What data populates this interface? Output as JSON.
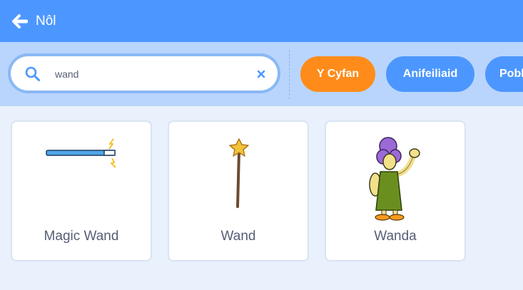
{
  "header": {
    "back_label": "Nôl",
    "back_icon": "arrow-left-icon",
    "color": "#4c97ff"
  },
  "search": {
    "value": "wand",
    "search_icon": "search-icon",
    "clear_icon": "close-icon"
  },
  "filters": [
    {
      "label": "Y Cyfan",
      "selected": true,
      "color": "#ff8c1a"
    },
    {
      "label": "Anifeiliaid",
      "selected": false,
      "color": "#4c97ff"
    },
    {
      "label": "Pobl",
      "selected": false,
      "color": "#4c97ff"
    }
  ],
  "results": [
    {
      "name": "Magic Wand",
      "thumbnail": "magic-wand-icon"
    },
    {
      "name": "Wand",
      "thumbnail": "star-wand-icon"
    },
    {
      "name": "Wanda",
      "thumbnail": "wanda-character-icon"
    }
  ]
}
